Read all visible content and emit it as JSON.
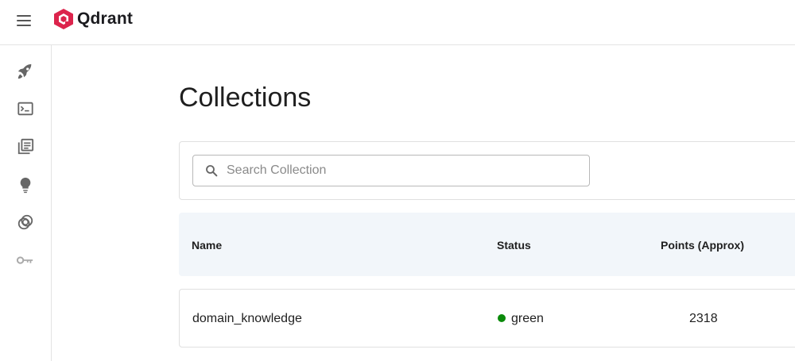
{
  "app": {
    "name": "Qdrant",
    "brand_color": "#dc244c"
  },
  "topbar": {
    "menu_icon": "hamburger-menu-icon"
  },
  "sidebar": {
    "items": [
      {
        "icon": "rocket-icon",
        "label": "Welcome"
      },
      {
        "icon": "console-icon",
        "label": "Console"
      },
      {
        "icon": "collections-icon",
        "label": "Collections"
      },
      {
        "icon": "lightbulb-icon",
        "label": "Tutorial"
      },
      {
        "icon": "datasets-icon",
        "label": "Datasets"
      },
      {
        "icon": "key-icon",
        "label": "Access"
      }
    ]
  },
  "page": {
    "title": "Collections"
  },
  "search": {
    "placeholder": "Search Collection",
    "value": ""
  },
  "table": {
    "headers": {
      "name": "Name",
      "status": "Status",
      "points": "Points (Approx)"
    },
    "rows": [
      {
        "name": "domain_knowledge",
        "status": "green",
        "status_color": "#0a8a0a",
        "points": "2318"
      }
    ]
  }
}
